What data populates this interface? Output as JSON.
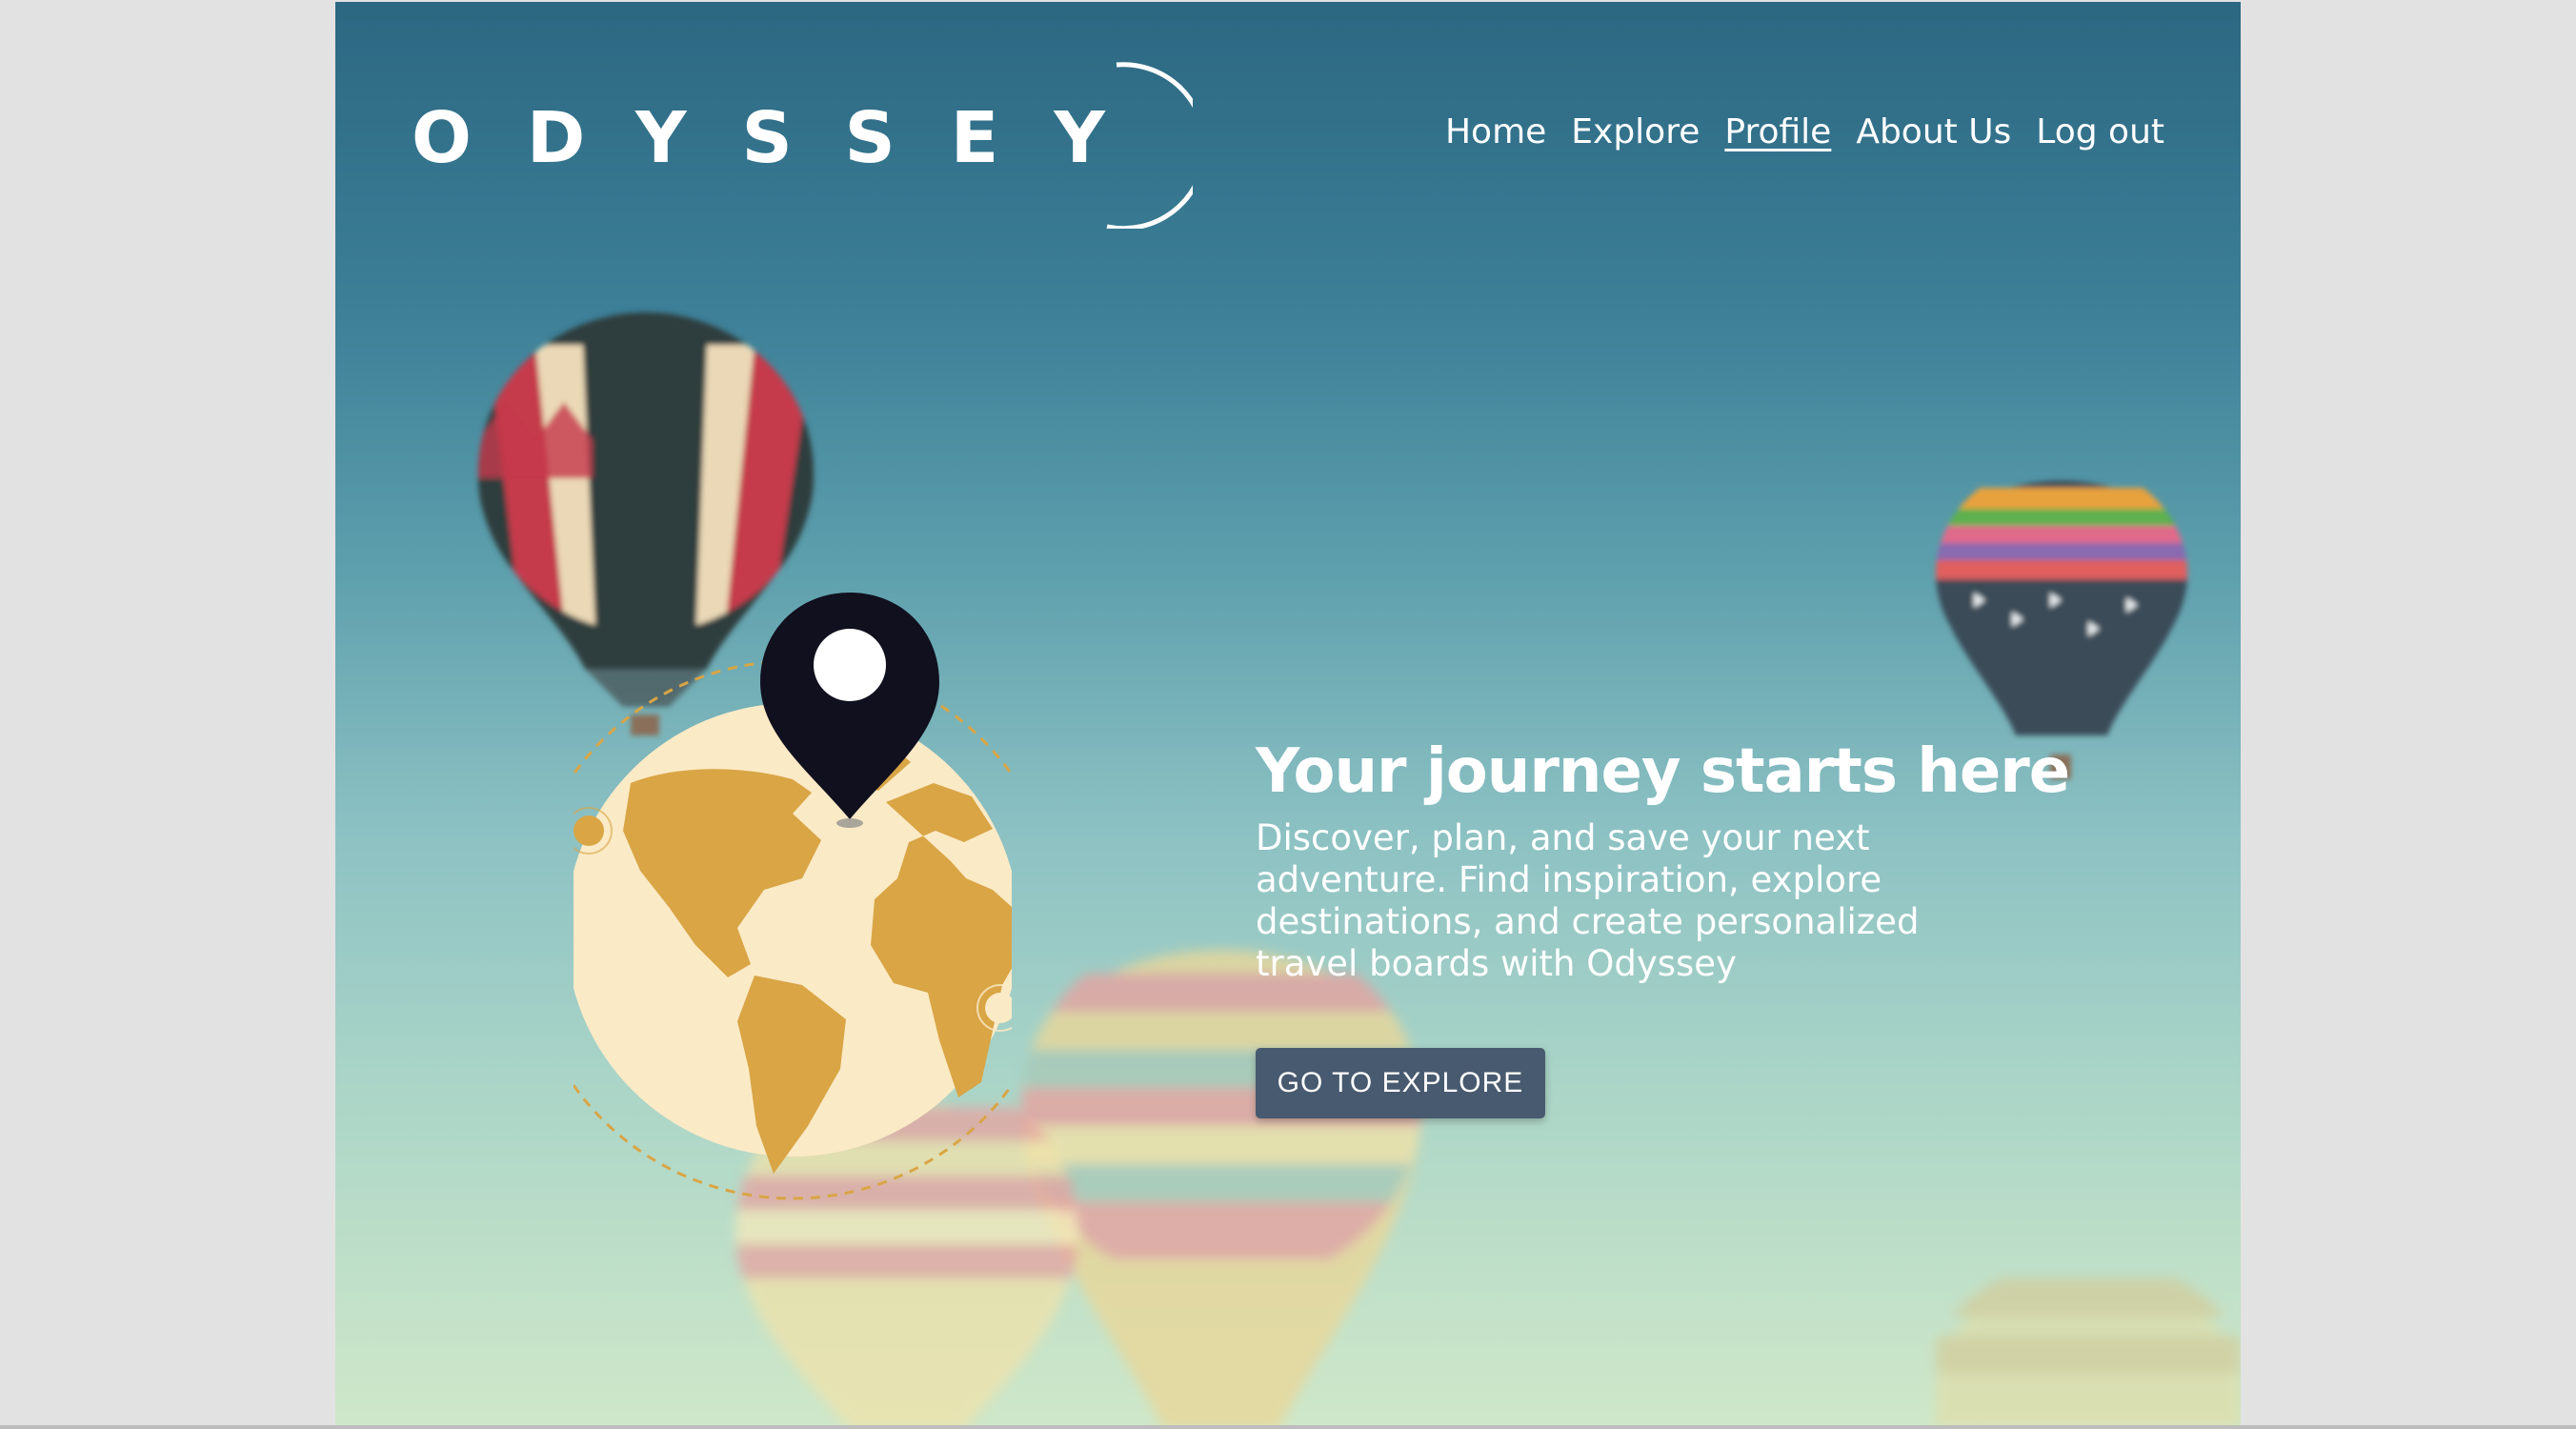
{
  "brand": {
    "logo_text": "ODYSSEY"
  },
  "nav": {
    "items": [
      {
        "label": "Home",
        "active": false
      },
      {
        "label": "Explore",
        "active": false
      },
      {
        "label": "Profile",
        "active": true
      },
      {
        "label": "About Us",
        "active": false
      },
      {
        "label": "Log out",
        "active": false
      }
    ]
  },
  "hero": {
    "title": "Your journey starts here",
    "description": "Discover, plan, and save your next adventure. Find inspiration, explore destinations, and create personalized travel boards with Odyssey",
    "cta_label": "GO TO EXPLORE"
  },
  "illustration": {
    "icons": [
      "globe-icon",
      "location-pin-icon",
      "hot-air-balloon-icon"
    ]
  },
  "colors": {
    "sky_top": "#2c6782",
    "sky_bottom": "#cfe7c9",
    "cta_background": "#485a6f",
    "globe_land": "#d9a545",
    "globe_ocean": "#fbeac6",
    "pin": "#11101f"
  }
}
